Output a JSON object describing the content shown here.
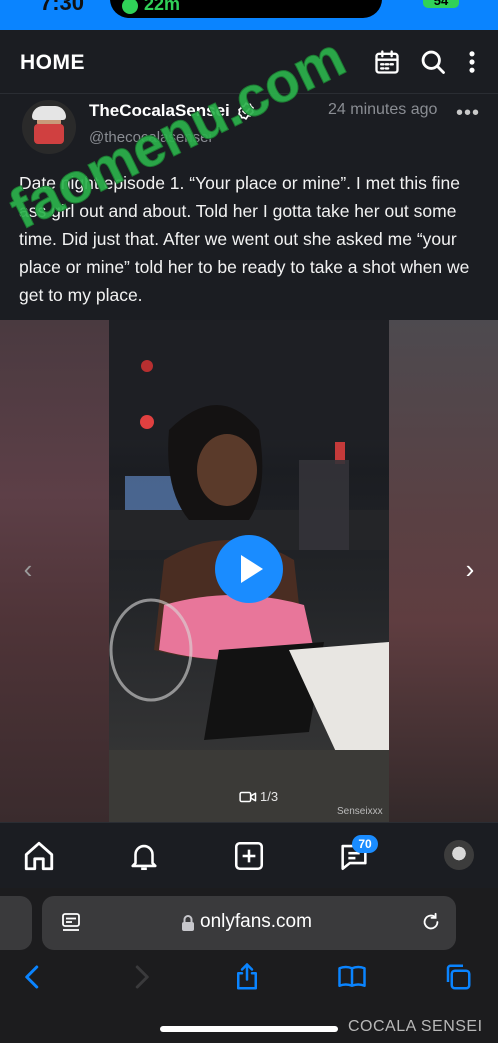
{
  "status_bar": {
    "time": "7:30",
    "activity": "22m",
    "battery": "54",
    "colors": {
      "background": "#0a84ff",
      "activity": "#30d158"
    }
  },
  "header": {
    "title": "HOME",
    "icons": [
      "calendar-icon",
      "search-icon",
      "more-vertical-icon"
    ]
  },
  "watermark": {
    "text": "faomenu.com",
    "color": "#2bb24c"
  },
  "post": {
    "author_name": "TheCocalaSensei",
    "author_handle": "@thecocalasensei",
    "time_ago": "24 minutes ago",
    "more_label": "•••",
    "text": "Date night episode 1. “Your place or mine”. I met this fine ass girl out and about. Told her I gotta take her out some time. Did just that. After we went out she asked me “your place or mine” told her to be ready to take a shot when we get to my place.",
    "media": {
      "counter": "1/3",
      "credit": "Senseixxx",
      "prev_label": "‹",
      "next_label": "›"
    }
  },
  "tabbar": {
    "items": [
      "home-icon",
      "bell-icon",
      "plus-square-icon",
      "chat-icon",
      "profile-avatar"
    ],
    "badge": "70",
    "accent": "#1a8cff"
  },
  "safari": {
    "url": "onlyfans.com",
    "bottom_credit": "COCALA SENSEI",
    "accent": "#0a84ff"
  }
}
